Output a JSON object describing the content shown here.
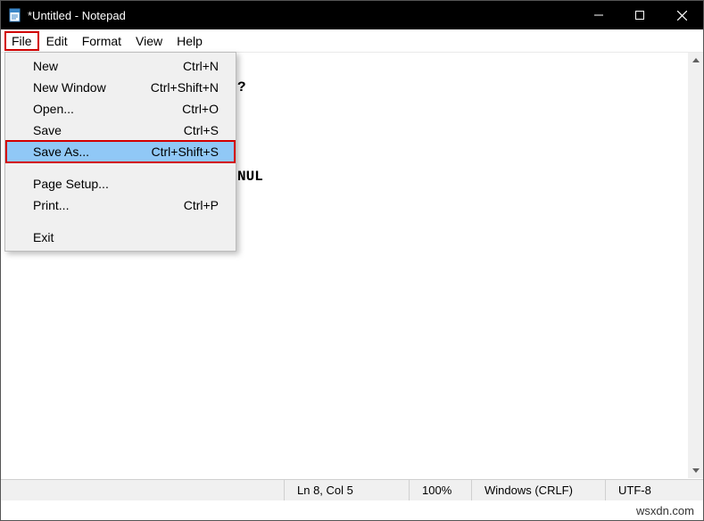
{
  "titlebar": {
    "title": "*Untitled - Notepad"
  },
  "menubar": {
    "file": "File",
    "edit": "Edit",
    "format": "Format",
    "view": "View",
    "help": "Help"
  },
  "dropdown": {
    "items": [
      {
        "label": "New",
        "shortcut": "Ctrl+N"
      },
      {
        "label": "New Window",
        "shortcut": "Ctrl+Shift+N"
      },
      {
        "label": "Open...",
        "shortcut": "Ctrl+O"
      },
      {
        "label": "Save",
        "shortcut": "Ctrl+S"
      },
      {
        "label": "Save As...",
        "shortcut": "Ctrl+Shift+S"
      },
      {
        "label": "Page Setup...",
        "shortcut": ""
      },
      {
        "label": "Print...",
        "shortcut": "Ctrl+P"
      },
      {
        "label": "Exit",
        "shortcut": ""
      }
    ]
  },
  "content": {
    "visible_text_1": "?",
    "visible_text_2": "NUL"
  },
  "statusbar": {
    "position": "Ln 8, Col 5",
    "zoom": "100%",
    "lineending": "Windows (CRLF)",
    "encoding": "UTF-8"
  },
  "watermark": "wsxdn.com"
}
